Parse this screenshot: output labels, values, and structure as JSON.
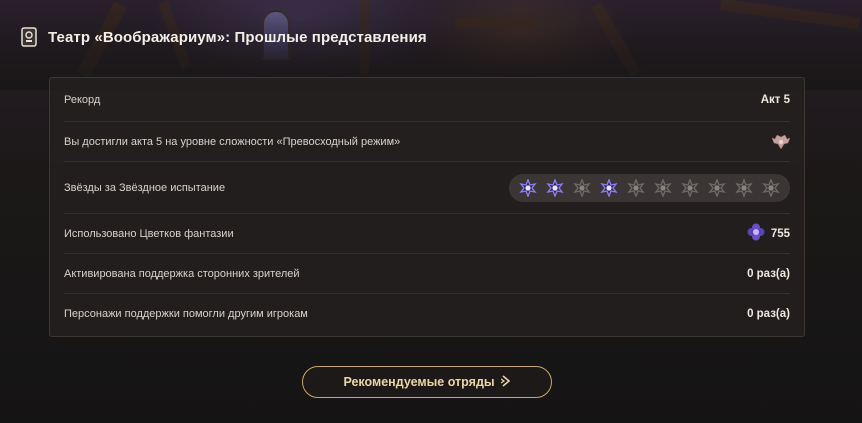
{
  "header": {
    "title": "Театр «Воображариум»: Прошлые представления",
    "icon": "theater-ticket-icon"
  },
  "stats": {
    "record_label": "Рекорд",
    "record_value": "Акт 5",
    "difficulty_label": "Вы достигли акта 5 на уровне сложности «Превосходный режим»",
    "difficulty_icon": "visionary-mode-emblem-icon",
    "stars_label": "Звёзды за Звёздное испытание",
    "stars": {
      "earned": [
        true,
        true,
        false,
        true,
        false,
        false,
        false,
        false,
        false,
        false
      ],
      "total": 10
    },
    "flowers_label": "Использовано Цветков фантазии",
    "flowers_value": "755",
    "flowers_icon": "fantasia-flower-icon",
    "support_activated_label": "Активирована поддержка сторонних зрителей",
    "support_activated_value": "0 раз(а)",
    "support_helped_label": "Персонажи поддержки помогли другим игрокам",
    "support_helped_value": "0 раз(а)"
  },
  "button": {
    "label": "Рекомендуемые отряды",
    "icon": "arrow-right-icon"
  },
  "colors": {
    "star_active": "#8b7cf0",
    "star_inactive": "#6f6966",
    "button_border": "#c9a869",
    "button_text": "#e9d6a8"
  }
}
